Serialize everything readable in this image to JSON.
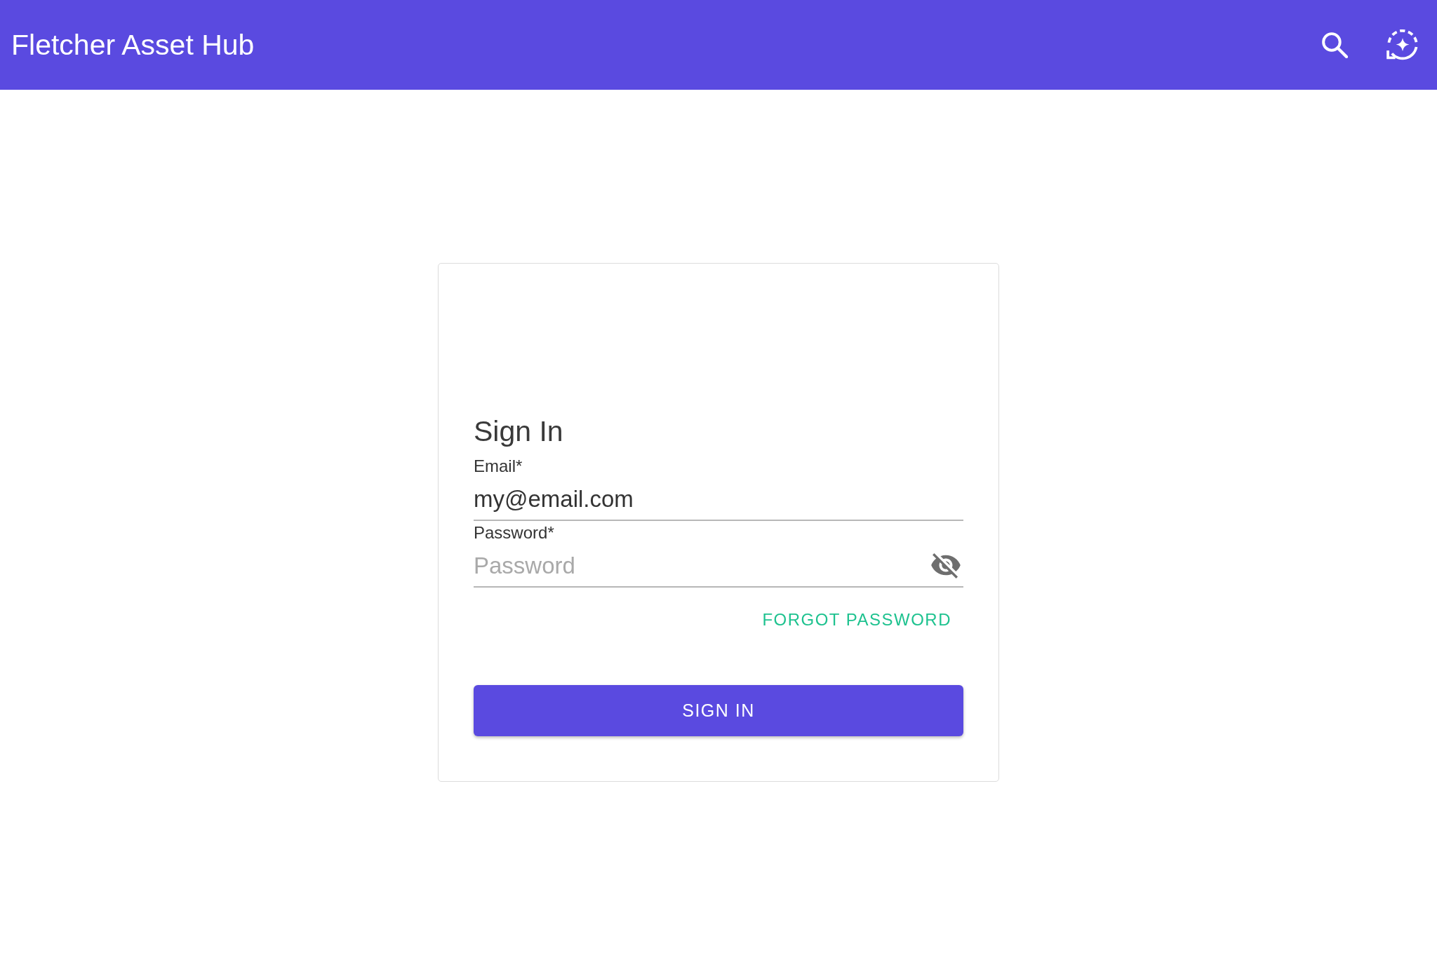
{
  "app_bar": {
    "title": "Fletcher Asset Hub"
  },
  "sign_in_card": {
    "title": "Sign In",
    "fields": [
      {
        "kind": "email",
        "label": "Email*",
        "value": "my@email.com"
      },
      {
        "kind": "password",
        "label": "Password*",
        "placeholder": "Password",
        "revealed": false
      }
    ],
    "forgot_password_link": "FORGOT PASSWORD",
    "submit_button": "SIGN IN"
  }
}
